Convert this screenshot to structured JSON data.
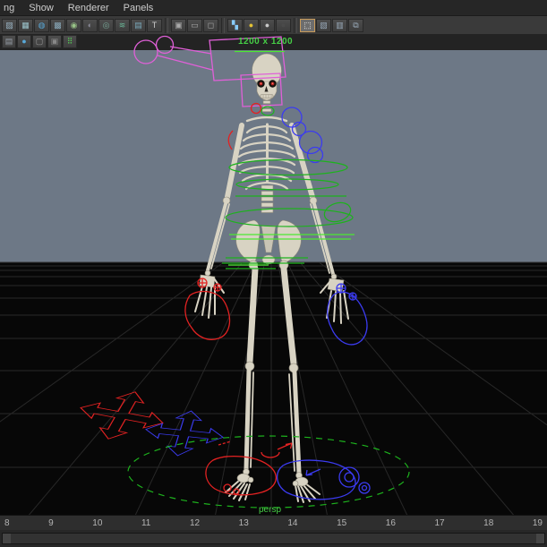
{
  "menu": {
    "items": [
      {
        "label": "ng"
      },
      {
        "label": "Show"
      },
      {
        "label": "Renderer"
      },
      {
        "label": "Panels"
      }
    ]
  },
  "toolbar": {
    "row1": [
      {
        "name": "clip-ghost-icon",
        "glyph": "▨",
        "color": "#9ab4c4"
      },
      {
        "name": "wireframe-icon",
        "glyph": "▦",
        "color": "#9cc4cc"
      },
      {
        "name": "shaded-sphere-icon",
        "glyph": "◍",
        "color": "#58a8d8"
      },
      {
        "name": "textured-sphere-icon",
        "glyph": "▩",
        "color": "#8aaabb"
      },
      {
        "name": "use-all-lights-icon",
        "glyph": "◉",
        "color": "#99c488"
      },
      {
        "name": "shadows-icon",
        "glyph": "◐",
        "color": "#8a8a99"
      },
      {
        "name": "screen-ao-icon",
        "glyph": "◎",
        "color": "#7aa999"
      },
      {
        "name": "motion-blur-icon",
        "glyph": "≋",
        "color": "#6bb899"
      },
      {
        "name": "multisample-icon",
        "glyph": "▤",
        "color": "#7aa9bb"
      },
      {
        "name": "title-safe-icon",
        "glyph": "T",
        "color": "#cccccc"
      },
      {
        "sep": true
      },
      {
        "name": "camera-select-icon",
        "glyph": "▣",
        "color": "#aaaaaa"
      },
      {
        "name": "film-gate-icon",
        "glyph": "▭",
        "color": "#aaaaaa"
      },
      {
        "name": "resolution-gate-icon",
        "glyph": "◻",
        "color": "#aaaaaa"
      },
      {
        "sep": true
      },
      {
        "name": "gate-mask-icon",
        "glyph": "▚",
        "color": "#88ccff"
      },
      {
        "name": "default-light-icon",
        "glyph": "●",
        "color": "#e3c235"
      },
      {
        "name": "flat-light-icon",
        "glyph": "●",
        "color": "#c9c9c9"
      },
      {
        "name": "no-light-icon",
        "glyph": "●",
        "color": "#4a4a4a"
      },
      {
        "sep": true
      },
      {
        "name": "isolate-select-icon",
        "glyph": "⬚",
        "color": "#ffffff",
        "selected": true
      },
      {
        "name": "xray-icon",
        "glyph": "▧",
        "color": "#9aabbb"
      },
      {
        "name": "xray-joints-icon",
        "glyph": "▥",
        "color": "#9aabbb"
      },
      {
        "name": "node-graph-icon",
        "glyph": "⧉",
        "color": "#9aabbb"
      }
    ],
    "row2": [
      {
        "name": "grid-toggle-icon",
        "glyph": "▤",
        "color": "#99a0aa"
      },
      {
        "name": "shaded-display-icon",
        "glyph": "●",
        "color": "#58a8d8"
      },
      {
        "name": "viewcube-icon",
        "glyph": "▢",
        "color": "#999999"
      },
      {
        "name": "gpu-cache-icon",
        "glyph": "▣",
        "color": "#888888"
      },
      {
        "name": "greenscreen-icon",
        "glyph": "⠿",
        "color": "#55cc55"
      }
    ]
  },
  "viewport": {
    "resolution_label": "1200 x 1200",
    "camera_label": "persp",
    "colors": {
      "sky": "#6d7886",
      "ground": "#070707",
      "grid": "#282828",
      "bone": "#d8d3c3",
      "pink": "#e060d8",
      "red": "#e32222",
      "blue": "#3b3bf0",
      "green": "#1db21d",
      "bgreen": "#4ce832",
      "label_green": "#46cf46"
    }
  },
  "timeline": {
    "ticks": [
      "8",
      "9",
      "10",
      "11",
      "12",
      "13",
      "14",
      "15",
      "16",
      "17",
      "18",
      "19"
    ]
  }
}
